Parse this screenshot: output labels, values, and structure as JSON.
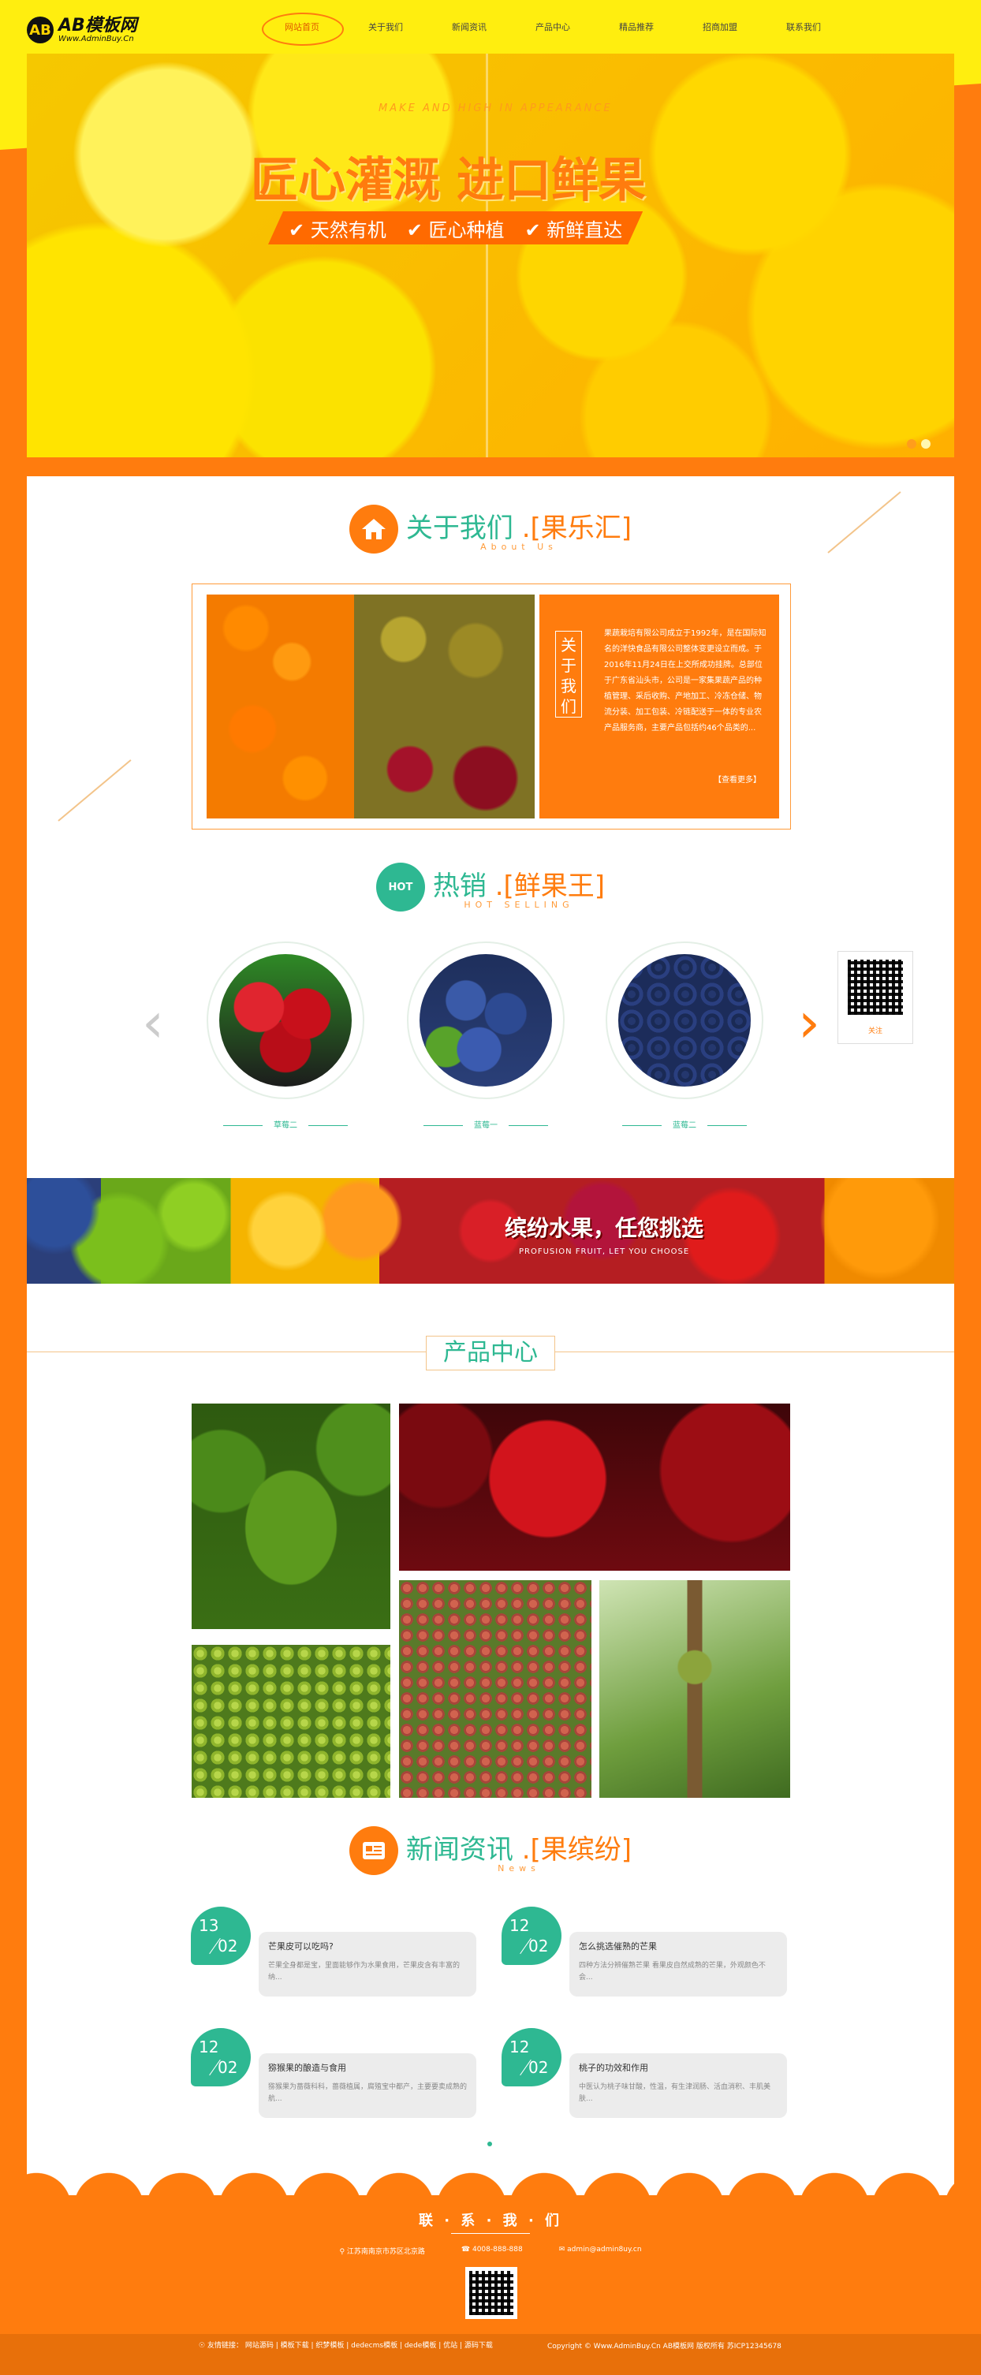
{
  "logo": {
    "mark": "AB",
    "name": "AB模板网",
    "url": "Www.AdminBuy.Cn"
  },
  "nav": [
    "网站首页",
    "关于我们",
    "新闻资讯",
    "产品中心",
    "精品推荐",
    "招商加盟",
    "联系我们"
  ],
  "banner": {
    "deco": "MAKE AND HIGH IN APPEARANCE",
    "title": "匠心灌溉 进口鲜果",
    "tags": [
      "天然有机",
      "匠心种植",
      "新鲜直达"
    ]
  },
  "about": {
    "title": "关于我们",
    "title_accent": ".[果乐汇]",
    "subtitle": "About Us",
    "vertical": "关于我们",
    "text": "果蔬栽培有限公司成立于1992年，是在国际知名的洋快食品有限公司整体变更设立而成。于2016年11月24日在上交所成功挂牌。总部位于广东省汕头市，公司是一家集果蔬产品的种植管理、采后收购、产地加工、冷冻仓储、物流分装、加工包装、冷链配送于一体的专业农产品服务商，主要产品包括约46个品类的...",
    "more": "【查看更多】"
  },
  "hot": {
    "title": "热销",
    "title_accent": ".[鲜果王]",
    "subtitle": "HOT SELLING",
    "icon_text": "HOT",
    "items": [
      "草莓二",
      "蓝莓一",
      "蓝莓二"
    ],
    "qr_label": "关注"
  },
  "strip": {
    "title": "缤纷水果，任您挑选",
    "subtitle": "PROFUSION FRUIT, LET YOU CHOOSE"
  },
  "products": {
    "title": "产品中心"
  },
  "news": {
    "title": "新闻资讯",
    "title_accent": ".[果缤纷]",
    "subtitle": "News",
    "items": [
      {
        "day": "13",
        "month": "02",
        "title": "芒果皮可以吃吗?",
        "text": "芒果全身都是宝，里面能够作为水果食用，芒果皮含有丰富的纳..."
      },
      {
        "day": "12",
        "month": "02",
        "title": "怎么挑选催熟的芒果",
        "text": "四种方法分辨催熟芒果 看果皮自然成熟的芒果，外观颜色不会..."
      },
      {
        "day": "12",
        "month": "02",
        "title": "猕猴果的酿造与食用",
        "text": "猕猴果为蔷薇科科，蔷薇植属，腐殖宝中都产，主要要卖成熟的航..."
      },
      {
        "day": "12",
        "month": "02",
        "title": "桃子的功效和作用",
        "text": "中医认为桃子味甘酸，性温，有生津润肠、活血消积、丰肌美肤..."
      }
    ]
  },
  "footer": {
    "contact_title": "联 · 系 · 我 · 们",
    "address": "江苏南南京市苏区北京路",
    "phone": "4008-888-888",
    "email": "admin@admin8uy.cn",
    "links_label": "友情链接：",
    "links": [
      "网站源码",
      "模板下载",
      "织梦模板",
      "dedecms模板",
      "dede模板",
      "优站",
      "源码下载"
    ],
    "copyright": "Copyright © Www.AdminBuy.Cn AB模板网 版权所有   苏ICP12345678"
  },
  "colors": {
    "orange": "#ff7c0e",
    "yellow": "#ffee0f",
    "green": "#2eb892"
  }
}
